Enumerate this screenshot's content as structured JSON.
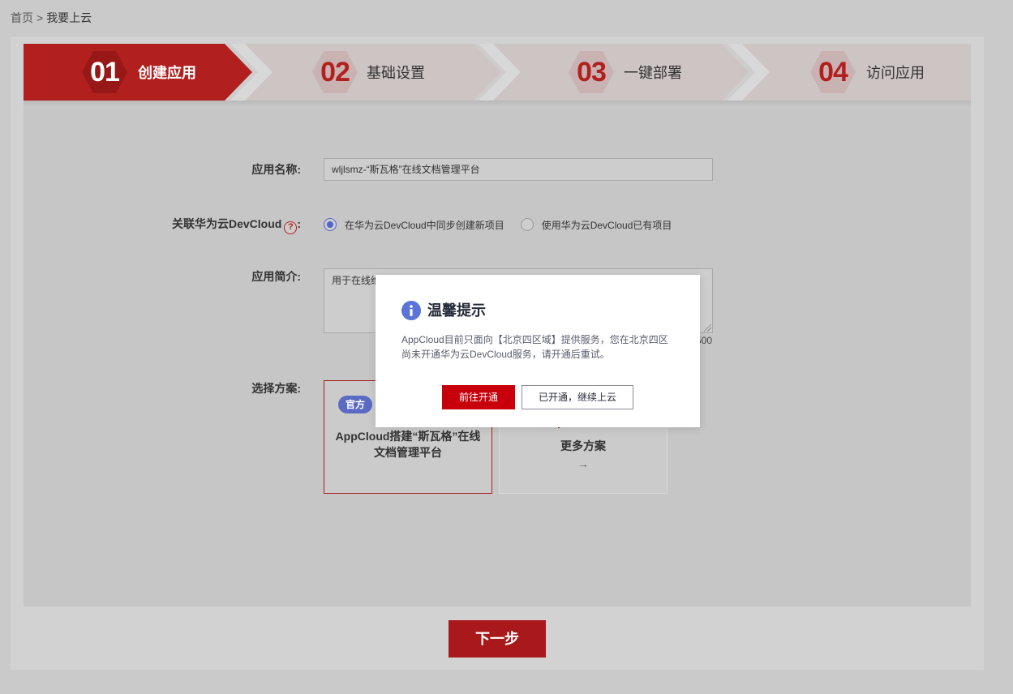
{
  "breadcrumb": {
    "home": "首页",
    "separator": ">",
    "current": "我要上云"
  },
  "steps": [
    {
      "num": "01",
      "label": "创建应用",
      "state": "active"
    },
    {
      "num": "02",
      "label": "基础设置",
      "state": "inactive"
    },
    {
      "num": "03",
      "label": "一键部署",
      "state": "inactive"
    },
    {
      "num": "04",
      "label": "访问应用",
      "state": "inactive"
    }
  ],
  "form": {
    "app_name_label": "应用名称:",
    "app_name_value": "wljlsmz-“斯瓦格”在线文档管理平台",
    "devcloud_label": "关联华为云DevCloud",
    "devcloud_help": "?",
    "devcloud_colon": ":",
    "radio_new": "在华为云DevCloud中同步创建新项目",
    "radio_existing": "使用华为云DevCloud已有项目",
    "radio_selected": "new",
    "intro_label": "应用简介:",
    "intro_value": "用于在线维",
    "intro_count": "500",
    "plan_label": "选择方案:"
  },
  "plans": {
    "official_badge": "官方",
    "official_title_line1": "AppCloud搭建“斯瓦格”在线",
    "official_title_line2": "文档管理平台",
    "more_title": "更多方案",
    "more_arrow": "→"
  },
  "next_button": "下一步",
  "modal": {
    "icon": "info-icon",
    "title": "温馨提示",
    "body_line1": "AppCloud目前只面向【北京四区域】提供服务，您在北京四区",
    "body_line2": "尚未开通华为云DevCloud服务，请开通后重试。",
    "primary_button": "前往开通",
    "secondary_button": "已开通，继续上云"
  },
  "colors": {
    "brand_red": "#b21f1f",
    "primary_red": "#c7000b",
    "info_blue": "#5b74d8",
    "radio_blue": "#4e63cc"
  }
}
